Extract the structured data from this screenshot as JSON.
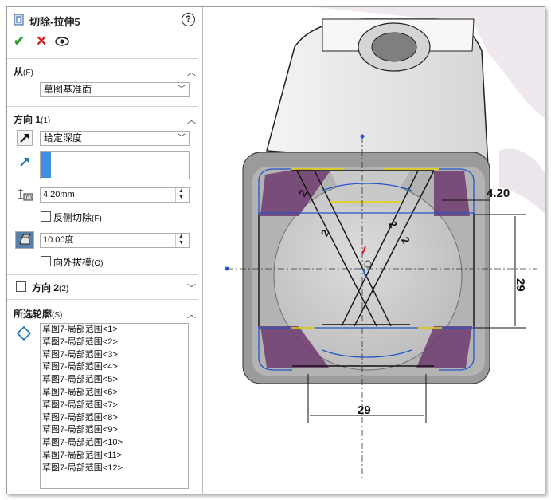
{
  "panel": {
    "title": "切除-拉伸5",
    "help": "?",
    "from_section": {
      "label": "从",
      "key": "(F)",
      "value": "草图基准面"
    },
    "direction1": {
      "label": "方向 1",
      "key": "(1)",
      "end_condition": "给定深度",
      "depth": "4.20mm",
      "flip_side_label": "反侧切除",
      "flip_side_key": "(F)",
      "draft_angle": "10.00度",
      "draft_outward_label": "向外拔模",
      "draft_outward_key": "(O)"
    },
    "direction2": {
      "label": "方向 2",
      "key": "(2)"
    },
    "contours": {
      "label": "所选轮廓",
      "key": "(S)",
      "items": [
        "草图7-局部范围<1>",
        "草图7-局部范围<2>",
        "草图7-局部范围<3>",
        "草图7-局部范围<4>",
        "草图7-局部范围<5>",
        "草图7-局部范围<6>",
        "草图7-局部范围<7>",
        "草图7-局部范围<8>",
        "草图7-局部范围<9>",
        "草图7-局部范围<10>",
        "草图7-局部范围<11>",
        "草图7-局部范围<12>"
      ]
    }
  },
  "viewport": {
    "dims": {
      "top_right": "4.20",
      "right_vertical": "29",
      "bottom": "29",
      "small_a": "2",
      "small_b": "2",
      "small_c": "2",
      "small_d": "2"
    }
  },
  "colors": {
    "accept": "#2e9d2e",
    "cancel": "#d42222",
    "sketch_blue": "#2255cc",
    "selected_yellow": "#e8d200",
    "region_purple": "#6e3b6e"
  },
  "icons": {
    "feature": "cut-extrude-icon",
    "accept": "check-icon",
    "cancel": "close-icon",
    "preview": "eye-icon"
  }
}
